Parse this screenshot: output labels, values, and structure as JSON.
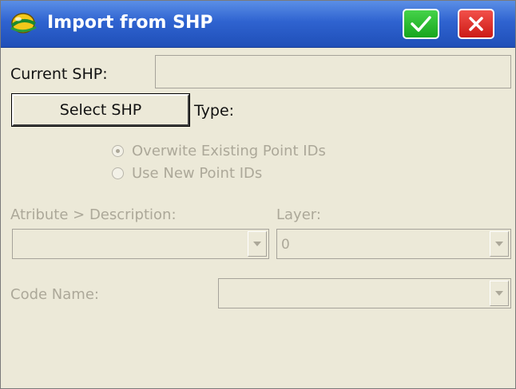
{
  "window": {
    "title": "Import from SHP",
    "icon": "surveyor-helmet-icon",
    "ok_icon": "checkmark-icon",
    "close_icon": "close-x-icon"
  },
  "form": {
    "current_shp_label": "Current SHP:",
    "current_shp_value": "",
    "select_shp_button": "Select SHP",
    "type_label": "Type:",
    "radio_overwrite": "Overwite Existing Point IDs",
    "radio_new": "Use New Point IDs",
    "radio_selected": "overwrite",
    "attribute_label": "Atribute > Description:",
    "attribute_value": "",
    "layer_label": "Layer:",
    "layer_value": "0",
    "code_name_label": "Code Name:",
    "code_name_value": ""
  },
  "colors": {
    "titlebar": "#2f63d0",
    "ok_button": "#1fb425",
    "close_button": "#e0302a",
    "disabled_text": "#aca899",
    "background": "#ece9d8"
  }
}
